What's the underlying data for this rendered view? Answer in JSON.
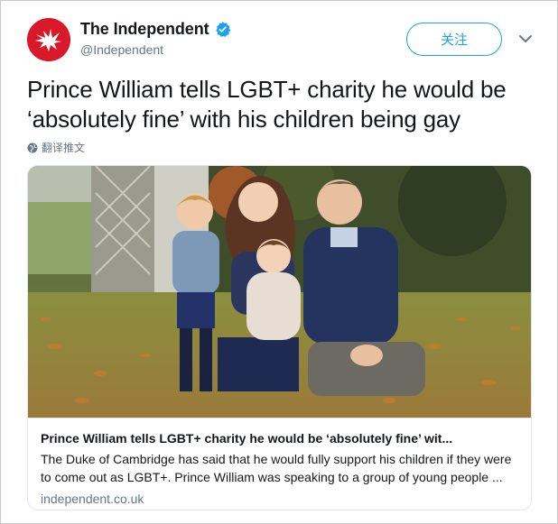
{
  "account": {
    "display_name": "The Independent",
    "handle": "@Independent",
    "verified": true,
    "avatar_icon": "eagle-logo-icon",
    "brand_color": "#d7192a"
  },
  "header": {
    "follow_label": "关注",
    "more_icon": "chevron-down-icon"
  },
  "tweet": {
    "text": "Prince William tells LGBT+ charity he would be ‘absolutely fine’ with his children being gay",
    "translate_label": "翻译推文",
    "translate_icon": "globe-icon"
  },
  "card": {
    "image_icon": "photo-family-icon",
    "title": "Prince William tells LGBT+ charity he would be ‘absolutely fine’ wit...",
    "description": "The Duke of Cambridge has said that he would fully support his children if they were to come out as LGBT+. Prince William was speaking to a group of young people ...",
    "domain": "independent.co.uk"
  },
  "colors": {
    "accent": "#1da1f2",
    "text": "#14171a",
    "muted": "#657786",
    "border": "#e1e8ed"
  }
}
